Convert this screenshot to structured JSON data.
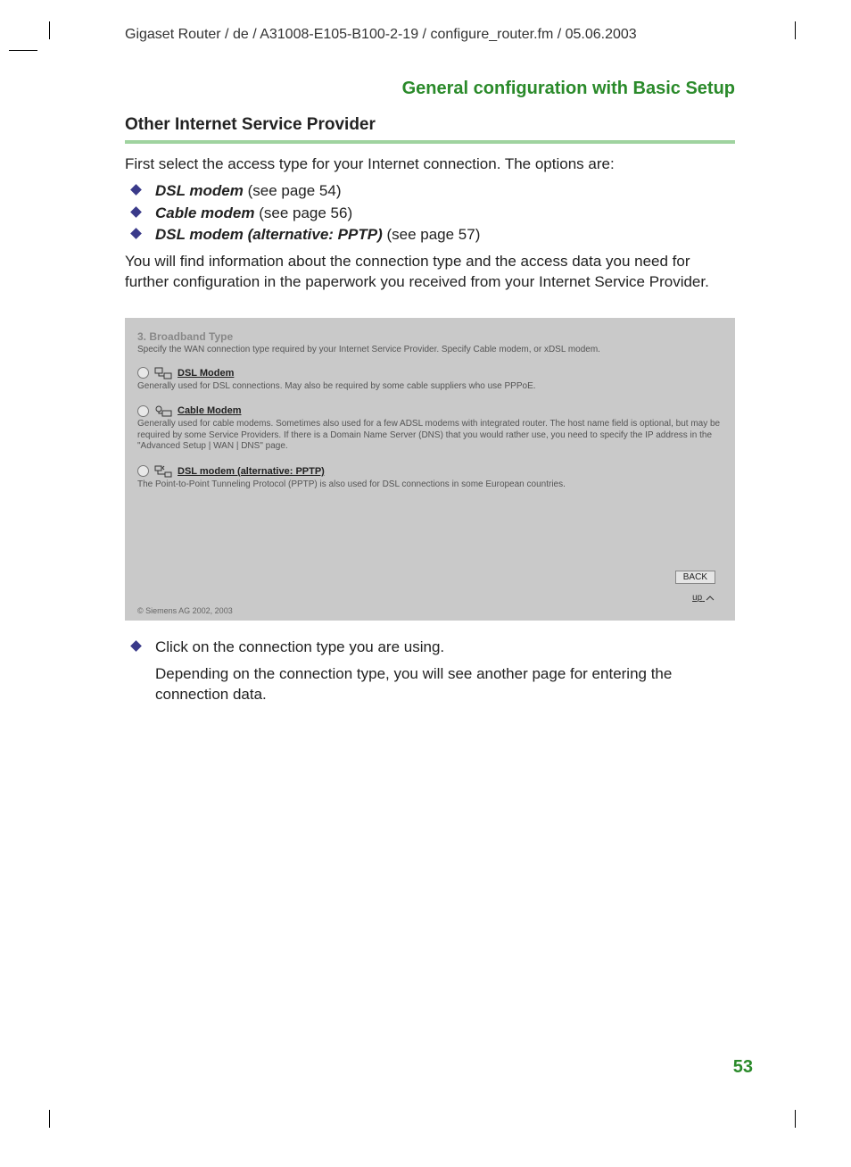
{
  "header": {
    "path": "Gigaset Router / de / A31008-E105-B100-2-19 / configure_router.fm / 05.06.2003"
  },
  "section": {
    "title": "General configuration with Basic Setup"
  },
  "subheading": "Other Internet Service Provider",
  "intro": "First select the access type for your Internet connection. The options are:",
  "options": [
    {
      "label": "DSL modem",
      "suffix": " (see page 54)"
    },
    {
      "label": "Cable modem",
      "suffix": " (see page 56)"
    },
    {
      "label": "DSL modem (alternative: PPTP)",
      "suffix": " (see page 57)"
    }
  ],
  "note": "You will find information about the connection type and the access data you need for further configuration in the paperwork you received from your Internet Service Provider.",
  "panel": {
    "title": "3. Broadband Type",
    "desc": "Specify the WAN connection type required by your Internet Service Provider. Specify Cable modem, or xDSL modem.",
    "opts": [
      {
        "label": "DSL Modem",
        "desc": "Generally used for DSL connections. May also be required by some cable suppliers who use PPPoE."
      },
      {
        "label": "Cable Modem",
        "desc": "Generally used for cable modems. Sometimes also used for a few ADSL modems with integrated router. The host name field is optional, but may be required by some Service Providers. If there is a Domain Name Server (DNS) that you would rather use, you need to specify the IP address in the \"Advanced Setup | WAN | DNS\" page."
      },
      {
        "label": "DSL modem (alternative: PPTP)",
        "desc": "The Point-to-Point Tunneling Protocol (PPTP) is also used for DSL connections in some European countries."
      }
    ],
    "back": "BACK",
    "up": "up",
    "copyright": "© Siemens AG 2002, 2003"
  },
  "after": {
    "line1": "Click on the connection type you are using.",
    "line2": "Depending on the connection type, you will see another page for entering the connection data."
  },
  "pageNumber": "53"
}
